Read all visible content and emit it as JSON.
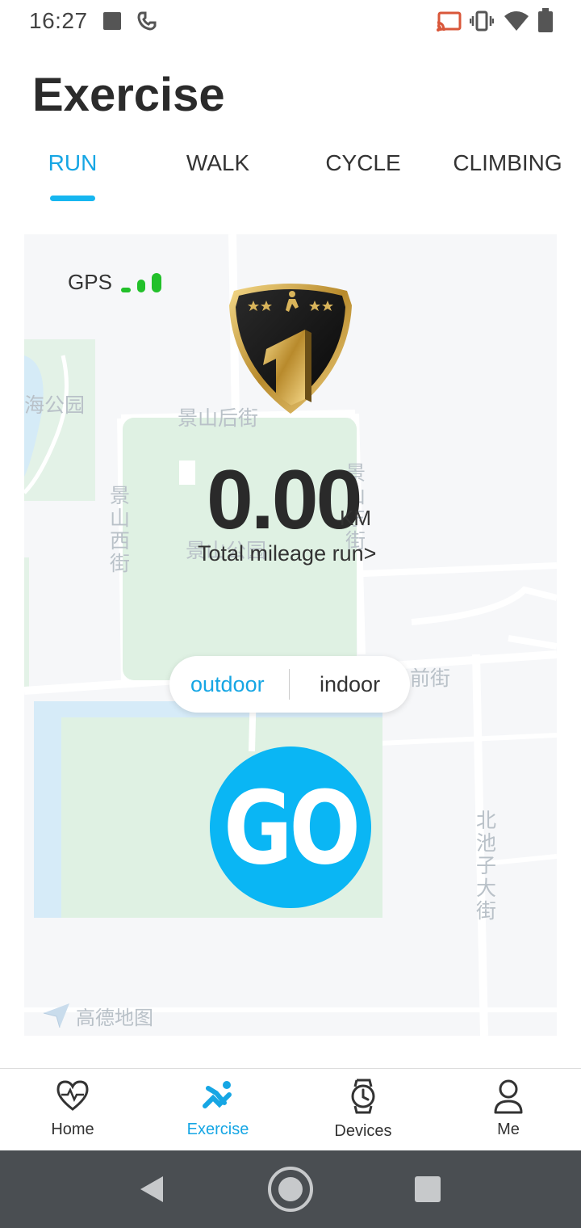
{
  "status_bar": {
    "time": "16:27",
    "icons": [
      "stop-icon",
      "call-icon",
      "cast-icon",
      "vibrate-icon",
      "wifi-icon",
      "battery-icon"
    ]
  },
  "page": {
    "title": "Exercise"
  },
  "tabs": [
    {
      "label": "RUN",
      "active": true
    },
    {
      "label": "WALK",
      "active": false
    },
    {
      "label": "CYCLE",
      "active": false
    },
    {
      "label": "CLIMBING",
      "active": false
    }
  ],
  "map": {
    "gps_label": "GPS",
    "labels": {
      "beihai": "海公园",
      "jingshan_hou": "景山后街",
      "jingshan_west": "景山西街",
      "jingshan_east": "景山东街",
      "jingshan_park": "景山公园",
      "qianjie": "前街",
      "beichizi": "北池子大街"
    },
    "provider": "高德地图"
  },
  "summary": {
    "distance": "0.00",
    "unit": "KM",
    "link": "Total mileage run>"
  },
  "mode": {
    "outdoor": "outdoor",
    "indoor": "indoor",
    "selected": "outdoor"
  },
  "go_button": {
    "label": "GO"
  },
  "bottom_nav": [
    {
      "label": "Home",
      "icon": "heart-pulse-icon",
      "active": false
    },
    {
      "label": "Exercise",
      "icon": "runner-icon",
      "active": true
    },
    {
      "label": "Devices",
      "icon": "watch-icon",
      "active": false
    },
    {
      "label": "Me",
      "icon": "person-icon",
      "active": false
    }
  ],
  "colors": {
    "accent": "#16a6e4",
    "go": "#0ab6f4",
    "gps": "#22c02a"
  }
}
